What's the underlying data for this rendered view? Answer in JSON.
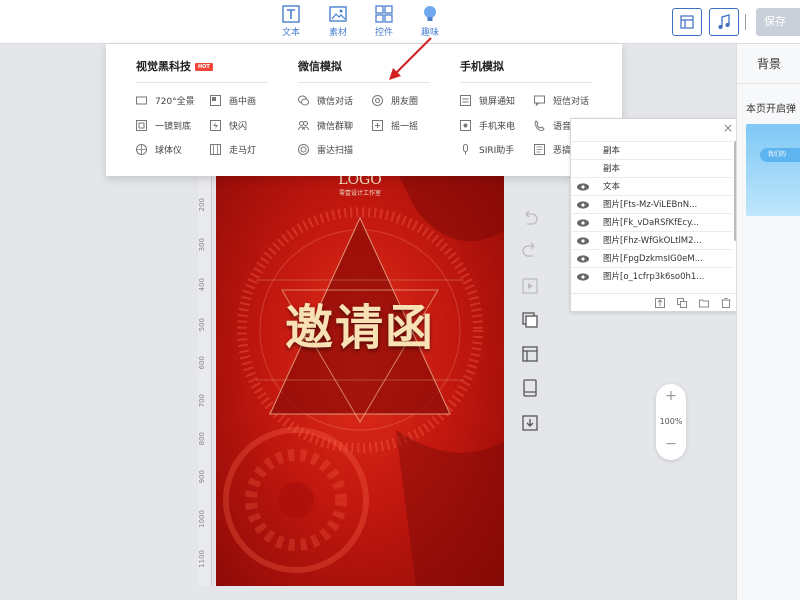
{
  "toolbar": {
    "items": [
      {
        "label": "文本",
        "icon": "text-icon"
      },
      {
        "label": "素材",
        "icon": "image-icon"
      },
      {
        "label": "控件",
        "icon": "widgets-icon"
      },
      {
        "label": "趣味",
        "icon": "bulb-icon"
      }
    ],
    "save_label": "保存",
    "accent": "#4a7fd0"
  },
  "dropdown": {
    "col1": {
      "title": "视觉黑科技",
      "badge": "HOT",
      "items": [
        "720°全景",
        "画中画",
        "一镜到底",
        "快闪",
        "球体仪",
        "走马灯"
      ]
    },
    "col2": {
      "title": "微信模拟",
      "items": [
        "微信对话",
        "朋友圈",
        "微信群聊",
        "摇一摇",
        "雷达扫描"
      ]
    },
    "col3": {
      "title": "手机模拟",
      "items": [
        "锁屏通知",
        "短信对话",
        "手机来电",
        "语音通话",
        "SIRI助手",
        "恶搞新闻"
      ]
    }
  },
  "ruler": {
    "marks": [
      "200",
      "300",
      "400",
      "500",
      "600",
      "700",
      "800",
      "900",
      "1000",
      "1100"
    ]
  },
  "poster": {
    "logo": "LOGO",
    "studio": "零壹设计工作室",
    "title": "邀请函",
    "colors": {
      "primary": "#c3180f",
      "title": "#f7e1b5"
    }
  },
  "layers": {
    "rows": [
      "副本",
      "副本",
      "文本",
      "图片[Fts-Mz-ViLEBnN...",
      "图片[Fk_vDaRSfKfEcy...",
      "图片[Fhz-WfGkOLtlM2...",
      "图片[FpgDzkmsIG0eM...",
      "图片[o_1cfrp3k6so0h1..."
    ]
  },
  "zoom": {
    "plus": "+",
    "value": "100%",
    "minus": "−"
  },
  "right_panel": {
    "title": "背景",
    "label": "本页开启弹",
    "preview_pill": "我们的"
  }
}
